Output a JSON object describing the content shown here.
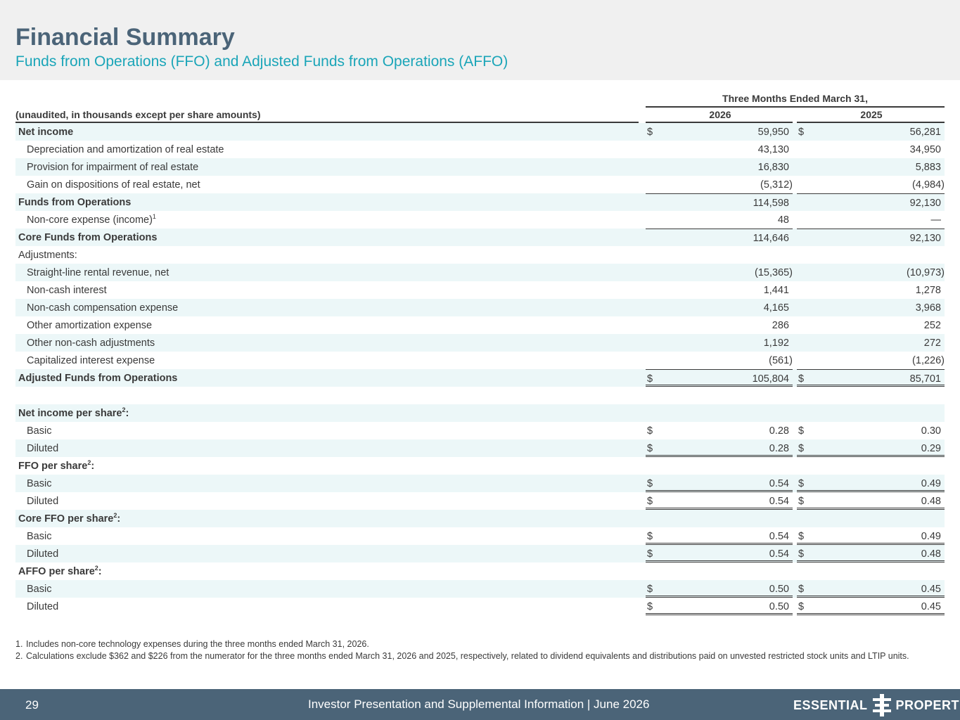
{
  "header": {
    "title": "Financial Summary",
    "subtitle": "Funds from Operations (FFO) and Adjusted Funds from Operations (AFFO)"
  },
  "table": {
    "period_heading": "Three Months Ended March 31,",
    "label_heading": "(unaudited, in thousands except per share amounts)",
    "years": [
      "2026",
      "2025"
    ],
    "rows": [
      {
        "label": "Net income",
        "v1": "59,950",
        "v2": "56,281"
      },
      {
        "label": "Depreciation and amortization of real estate",
        "v1": "43,130",
        "v2": "34,950"
      },
      {
        "label": "Provision for impairment of real estate",
        "v1": "16,830",
        "v2": "5,883"
      },
      {
        "label": "Gain on dispositions of real estate, net",
        "v1": "(5,312)",
        "v2": "(4,984)"
      },
      {
        "label": "Funds from Operations",
        "v1": "114,598",
        "v2": "92,130"
      },
      {
        "label": "Non-core expense (income)",
        "sup": "1",
        "v1": "48",
        "v2": "—"
      },
      {
        "label": "Core Funds from Operations",
        "v1": "114,646",
        "v2": "92,130"
      },
      {
        "label": "Adjustments:"
      },
      {
        "label": "Straight-line rental revenue, net",
        "v1": "(15,365)",
        "v2": "(10,973)"
      },
      {
        "label": "Non-cash interest",
        "v1": "1,441",
        "v2": "1,278"
      },
      {
        "label": "Non-cash compensation expense",
        "v1": "4,165",
        "v2": "3,968"
      },
      {
        "label": "Other amortization expense",
        "v1": "286",
        "v2": "252"
      },
      {
        "label": "Other non-cash adjustments",
        "v1": "1,192",
        "v2": "272"
      },
      {
        "label": "Capitalized interest expense",
        "v1": "(561)",
        "v2": "(1,226)"
      },
      {
        "label": "Adjusted Funds from Operations",
        "v1": "105,804",
        "v2": "85,701"
      },
      {
        "label": ""
      },
      {
        "label": "Net income per share",
        "sup": "2",
        "suffix": ":"
      },
      {
        "label": "Basic",
        "v1": "0.28",
        "v2": "0.30"
      },
      {
        "label": "Diluted",
        "v1": "0.28",
        "v2": "0.29"
      },
      {
        "label": "FFO per share",
        "sup": "2",
        "suffix": ":"
      },
      {
        "label": "Basic",
        "v1": "0.54",
        "v2": "0.49"
      },
      {
        "label": "Diluted",
        "v1": "0.54",
        "v2": "0.48"
      },
      {
        "label": "Core FFO per share",
        "sup": "2",
        "suffix": ":"
      },
      {
        "label": "Basic",
        "v1": "0.54",
        "v2": "0.49"
      },
      {
        "label": "Diluted",
        "v1": "0.54",
        "v2": "0.48"
      },
      {
        "label": "AFFO per share",
        "sup": "2",
        "suffix": ":"
      },
      {
        "label": "Basic",
        "v1": "0.50",
        "v2": "0.45"
      },
      {
        "label": "Diluted",
        "v1": "0.50",
        "v2": "0.45"
      }
    ],
    "currency_symbol": "$"
  },
  "footnotes": [
    {
      "num": "1.",
      "text": "Includes non-core technology expenses during the three months ended March 31, 2026."
    },
    {
      "num": "2.",
      "text": "Calculations exclude $362 and $226 from the numerator for the three months ended March 31, 2026 and 2025, respectively, related to dividend equivalents and distributions paid on unvested restricted stock units and LTIP units."
    }
  ],
  "footer": {
    "page_number": "29",
    "text": "Investor Presentation and Supplemental Information |  June 2026",
    "logo_left": "ESSENTIAL",
    "logo_right": "PROPERTIES"
  },
  "colors": {
    "title": "#4b6478",
    "subtitle": "#1aa5b8",
    "row_shade": "#ecf7f8",
    "footer_bg": "#4b6478"
  }
}
